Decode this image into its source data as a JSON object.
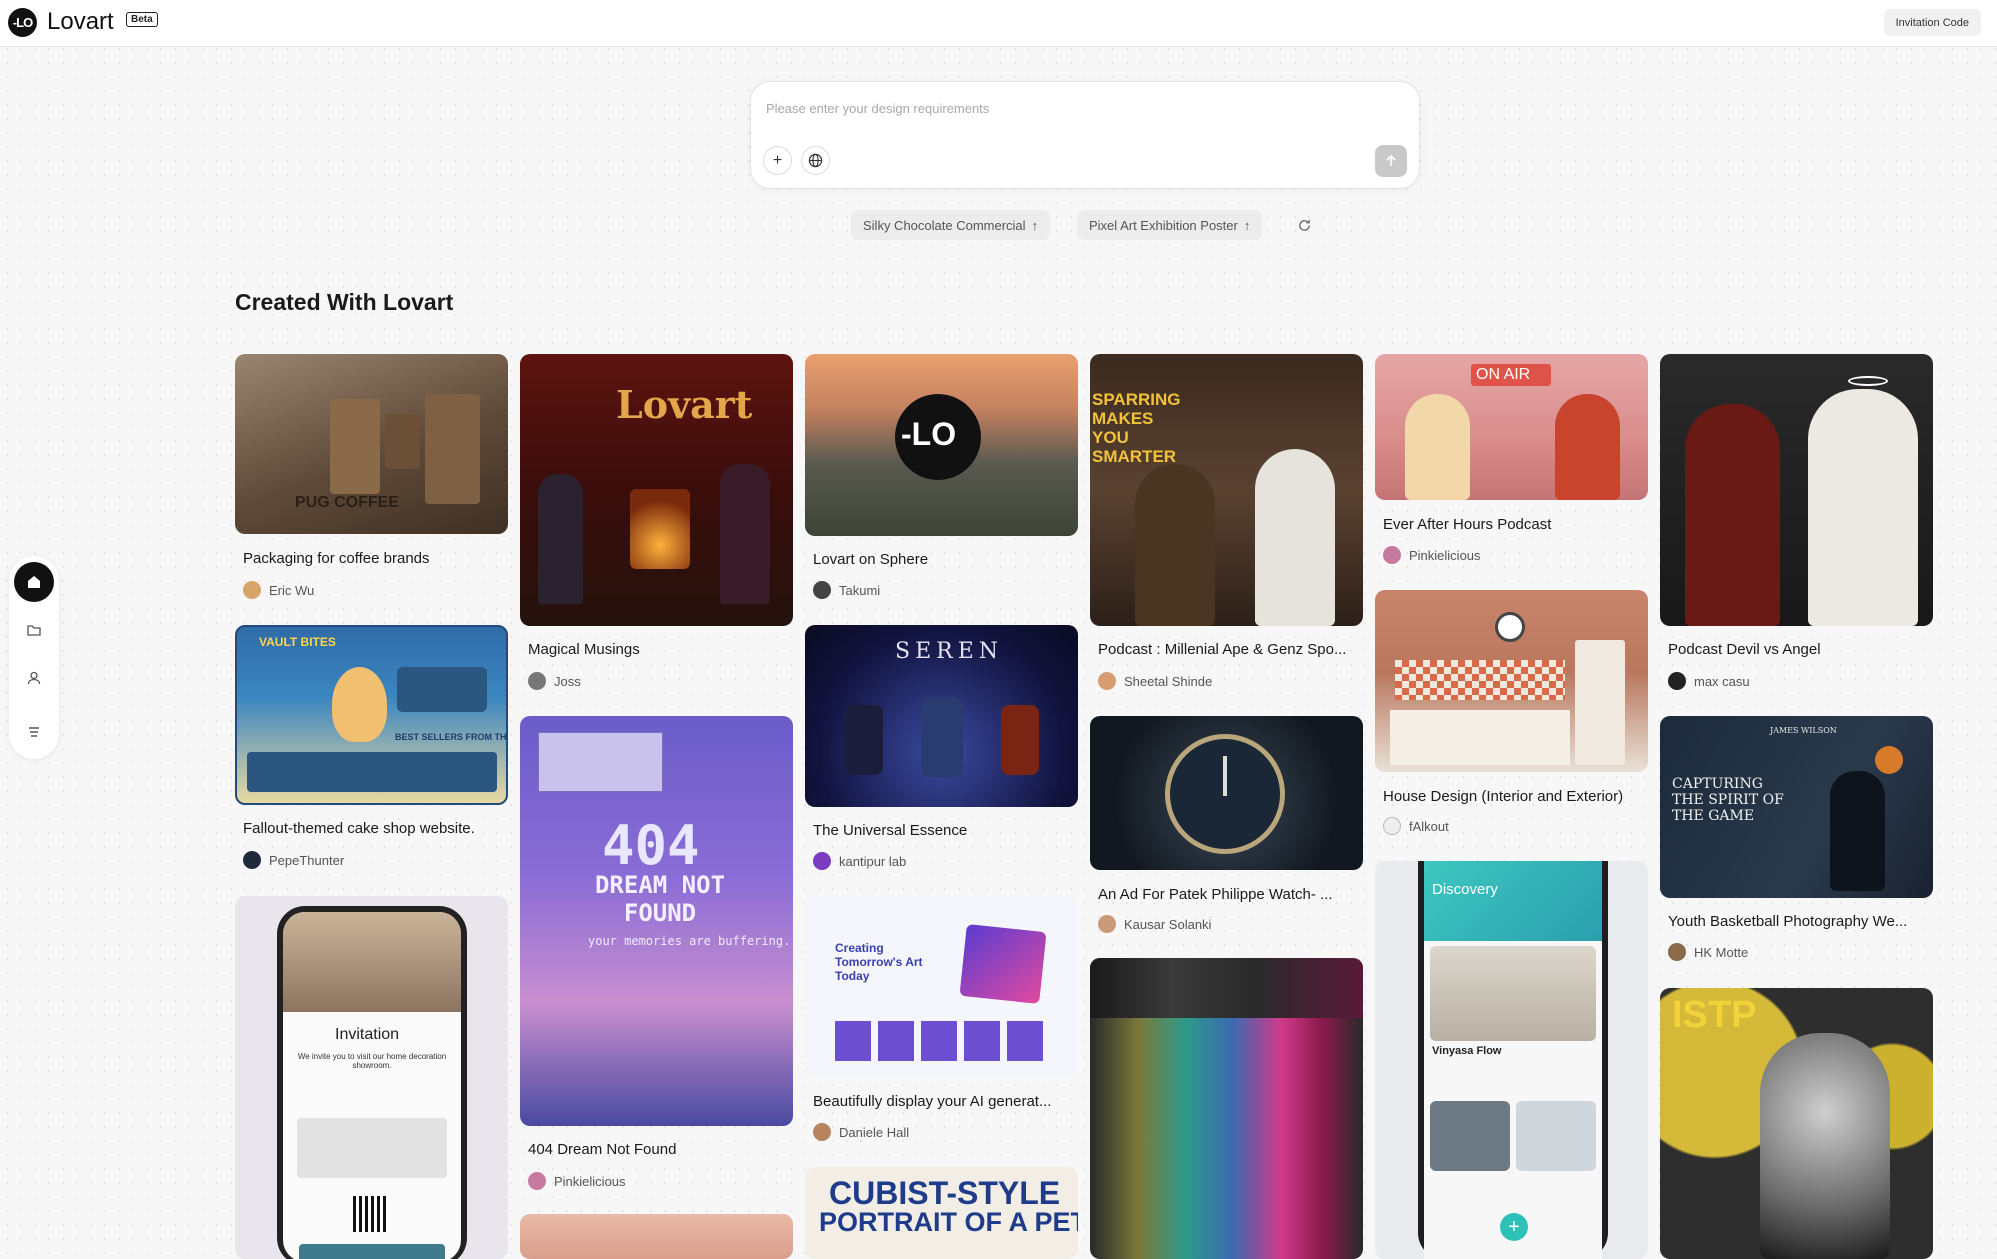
{
  "header": {
    "logo_mark": "-LO",
    "brand": "Lovart",
    "beta": "Beta",
    "invitation_button": "Invitation Code"
  },
  "prompt": {
    "placeholder": "Please enter your design requirements",
    "add_icon": "plus-icon",
    "globe_icon": "globe-icon",
    "send_icon": "arrow-up-icon"
  },
  "suggestions": [
    {
      "label": "Silky Chocolate Commercial",
      "icon": "↑"
    },
    {
      "label": "Pixel Art Exhibition Poster",
      "icon": "↑"
    }
  ],
  "section_title": "Created With Lovart",
  "sidebar": [
    "home-icon",
    "folder-icon",
    "user-icon",
    "menu-icon"
  ],
  "cards": [
    {
      "title": "Packaging for coffee brands",
      "author": "Eric Wu",
      "thumb_text": "PUG COFFEE"
    },
    {
      "title": "Fallout-themed cake shop website.",
      "author": "PepeThunter",
      "thumb_text": "VAULT BITES",
      "thumb_sub": "BEST SELLERS FROM THE WASTELAND"
    },
    {
      "title": "",
      "author": "",
      "thumb_text": "Invitation",
      "thumb_sub": "We invite you to visit our home decoration showroom."
    },
    {
      "title": "Magical Musings",
      "author": "Joss",
      "thumb_text": "Lovart"
    },
    {
      "title": "404 Dream Not Found",
      "author": "Pinkielicious",
      "thumb_text": "404",
      "thumb_sub": "DREAM NOT FOUND",
      "thumb_sub2": "your memories are buffering..."
    },
    {
      "title": "Lovart on Sphere",
      "author": "Takumi",
      "thumb_text": "-LO"
    },
    {
      "title": "The Universal Essence",
      "author": "kantipur lab",
      "thumb_text": "SEREN"
    },
    {
      "title": "Beautifully display your AI generat...",
      "author": "Daniele Hall",
      "thumb_text": "Creating Tomorrow's Art Today"
    },
    {
      "title": "",
      "author": "",
      "thumb_text": "CUBIST-STYLE",
      "thumb_sub": "PORTRAIT OF A PET"
    },
    {
      "title": "Podcast : Millenial Ape & Genz Spo...",
      "author": "Sheetal Shinde",
      "thumb_text": "SPARRING MAKES YOU SMARTER"
    },
    {
      "title": "An Ad For Patek Philippe Watch- ...",
      "author": "Kausar Solanki",
      "thumb_text": ""
    },
    {
      "title": "Ever After Hours Podcast",
      "author": "Pinkielicious",
      "thumb_text": "ON AIR"
    },
    {
      "title": "House Design (Interior and Exterior)",
      "author": "fAlkout",
      "thumb_text": ""
    },
    {
      "title": "",
      "author": "",
      "thumb_text": "Discovery",
      "thumb_sub": "Vinyasa Flow"
    },
    {
      "title": "Podcast Devil vs Angel",
      "author": "max casu",
      "thumb_text": ""
    },
    {
      "title": "Youth Basketball Photography We...",
      "author": "HK Motte",
      "thumb_text": "CAPTURING THE SPIRIT OF THE GAME",
      "thumb_sub": "JAMES WILSON"
    },
    {
      "title": "",
      "author": "",
      "thumb_text": "ISTP"
    }
  ]
}
